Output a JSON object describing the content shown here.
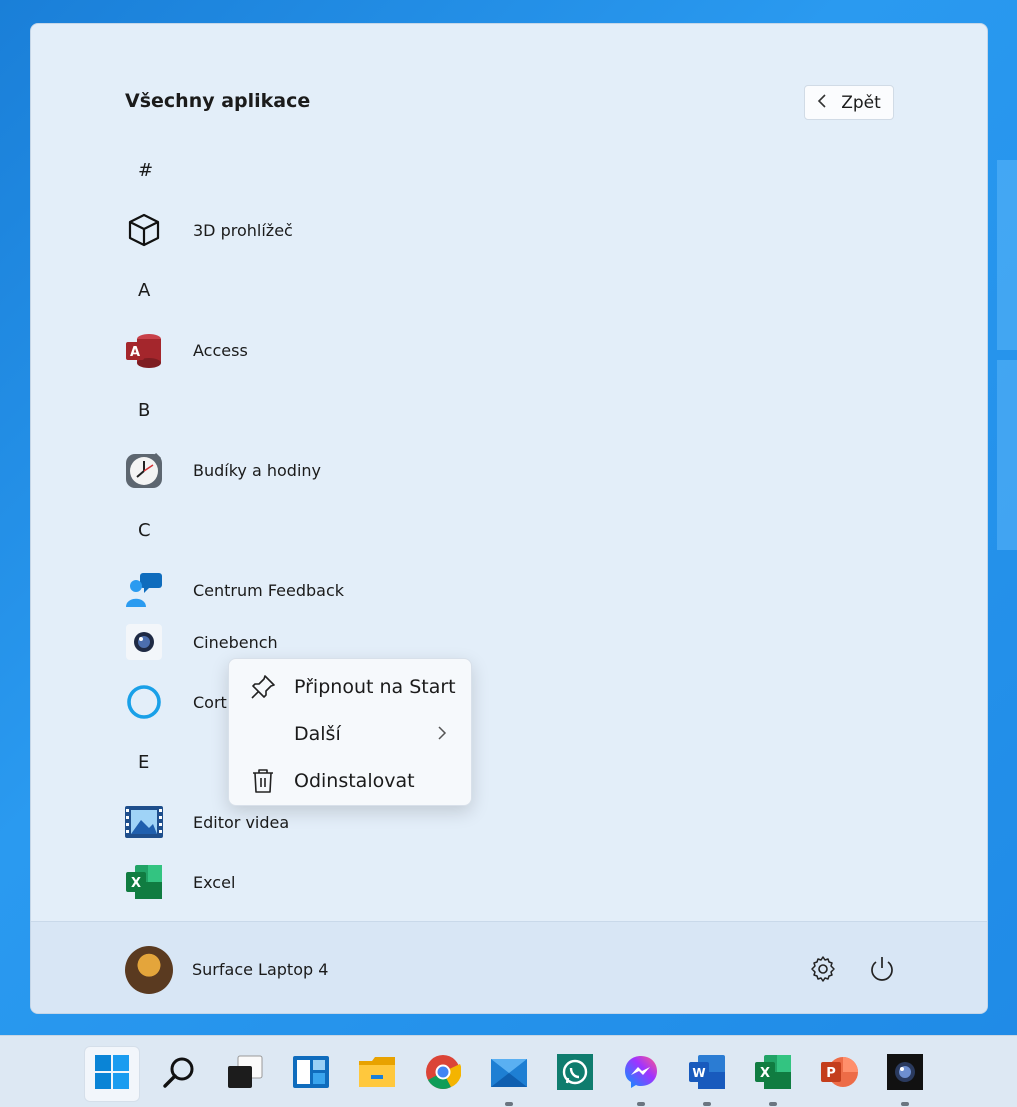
{
  "start_menu": {
    "title": "Všechny aplikace",
    "back_label": "Zpět",
    "groups": [
      {
        "letter": "#",
        "apps": [
          {
            "name": "3D prohlížeč",
            "icon": "cube-icon"
          }
        ]
      },
      {
        "letter": "A",
        "apps": [
          {
            "name": "Access",
            "icon": "access-icon"
          }
        ]
      },
      {
        "letter": "B",
        "apps": [
          {
            "name": "Budíky a hodiny",
            "icon": "alarm-clock-icon"
          }
        ]
      },
      {
        "letter": "C",
        "apps": [
          {
            "name": "Centrum Feedback",
            "icon": "feedback-hub-icon"
          },
          {
            "name": "Cinebench",
            "icon": "cinebench-icon"
          },
          {
            "name": "Cort",
            "icon": "cortana-icon"
          }
        ]
      },
      {
        "letter": "E",
        "apps": [
          {
            "name": "Editor videa",
            "icon": "video-editor-icon"
          },
          {
            "name": "Excel",
            "icon": "excel-icon"
          }
        ]
      }
    ],
    "user_name": "Surface Laptop 4"
  },
  "context_menu": {
    "items": [
      {
        "label": "Připnout na Start",
        "icon": "pin-icon"
      },
      {
        "label": "Další",
        "icon": "",
        "submenu": true
      },
      {
        "label": "Odinstalovat",
        "icon": "trash-icon"
      }
    ]
  },
  "taskbar": {
    "items": [
      {
        "name": "start",
        "icon": "windows-logo-icon",
        "active": true,
        "running": false
      },
      {
        "name": "search",
        "icon": "search-icon",
        "active": false,
        "running": false
      },
      {
        "name": "task-view",
        "icon": "task-view-icon",
        "active": false,
        "running": false
      },
      {
        "name": "widgets",
        "icon": "widgets-icon",
        "active": false,
        "running": false
      },
      {
        "name": "file-explorer",
        "icon": "folder-icon",
        "active": false,
        "running": false
      },
      {
        "name": "chrome",
        "icon": "chrome-icon",
        "active": false,
        "running": false
      },
      {
        "name": "mail",
        "icon": "mail-icon",
        "active": false,
        "running": true
      },
      {
        "name": "whatsapp",
        "icon": "whatsapp-icon",
        "active": false,
        "running": false
      },
      {
        "name": "messenger",
        "icon": "messenger-icon",
        "active": false,
        "running": true
      },
      {
        "name": "word",
        "icon": "word-icon",
        "active": false,
        "running": true
      },
      {
        "name": "excel",
        "icon": "excel-icon",
        "active": false,
        "running": true
      },
      {
        "name": "powerpoint",
        "icon": "powerpoint-icon",
        "active": false,
        "running": false
      },
      {
        "name": "cinebench",
        "icon": "cinebench-icon",
        "active": false,
        "running": true
      }
    ]
  },
  "colors": {
    "access_red": "#a4262c",
    "excel_green": "#107c41",
    "word_blue": "#185abd",
    "powerpoint_orange": "#c43e1c",
    "accent_blue": "#0078d4"
  }
}
